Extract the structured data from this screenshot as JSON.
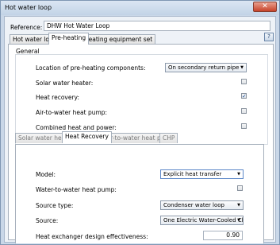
{
  "window": {
    "title": "Hot water loop",
    "close_glyph": "✕"
  },
  "reference": {
    "label": "Reference:",
    "value": "DHW Hot Water Loop"
  },
  "main_tabs": [
    {
      "label": "Hot water loop"
    },
    {
      "label": "Pre-heating"
    },
    {
      "label": "Heating equipment set"
    }
  ],
  "help_button": {
    "icon": "help-icon",
    "glyph": "?"
  },
  "general": {
    "label": "General",
    "location": {
      "label": "Location of pre-heating components:",
      "value": "On secondary return pipe"
    },
    "solar_water_heater": {
      "label": "Solar water heater:",
      "checked": false
    },
    "heat_recovery": {
      "label": "Heat recovery:",
      "checked": true,
      "check_glyph": "✓"
    },
    "air_to_water_heat_pump": {
      "label": "Air-to-water heat pump:",
      "checked": false
    },
    "combined_heat_and_power": {
      "label": "Combined heat and power:",
      "checked": false
    }
  },
  "sub_tabs": [
    {
      "label": "Solar water heater"
    },
    {
      "label": "Heat Recovery"
    },
    {
      "label": "Air-to-water heat pump"
    },
    {
      "label": "CHP"
    }
  ],
  "heat_recovery": {
    "model": {
      "label": "Model:",
      "value": "Explicit heat transfer"
    },
    "water_to_water_heat_pump": {
      "label": "Water-to-water heat pump:",
      "checked": false
    },
    "source_type": {
      "label": "Source type:",
      "value": "Condenser water loop"
    },
    "source": {
      "label": "Source:",
      "value": "One Electric Water-Cooled Chille"
    },
    "effectiveness": {
      "label": "Heat exchanger design effectiveness:",
      "value": "0.90"
    }
  },
  "dropdown_arrow": "▼"
}
